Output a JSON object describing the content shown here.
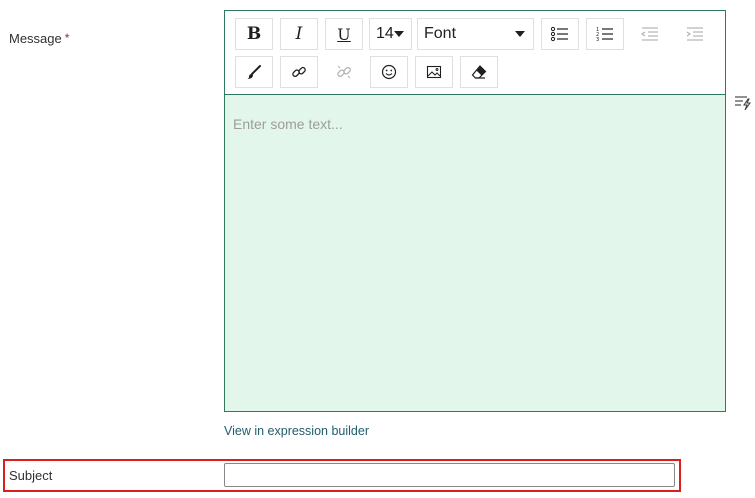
{
  "message": {
    "label": "Message",
    "required_mark": "*",
    "toolbar": {
      "bold": "B",
      "italic": "I",
      "underline": "U",
      "font_size": "14",
      "font": "Font"
    },
    "placeholder": "Enter some text...",
    "expression_link": "View in expression builder"
  },
  "subject": {
    "label": "Subject",
    "value": ""
  },
  "colors": {
    "editor_border": "#2f7a5c",
    "editor_bg": "#e2f6ec",
    "highlight": "#d9201f",
    "link": "#215d6b"
  }
}
